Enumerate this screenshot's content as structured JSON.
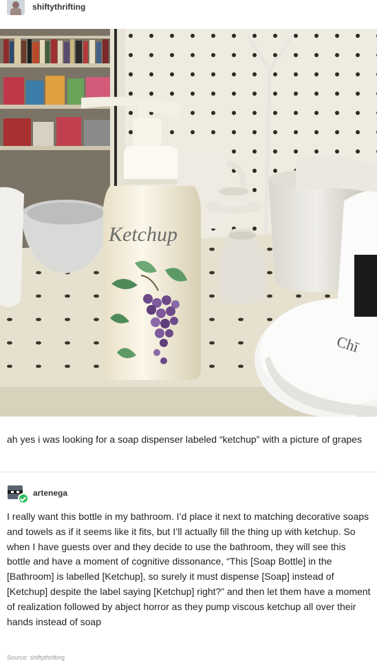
{
  "post": {
    "username": "shiftythrifting",
    "caption": "ah yes i was looking for a soap dispenser labeled “ketchup” with a picture of grapes"
  },
  "photo": {
    "label_text": "Ketchup",
    "mug_partial_text": "Chī"
  },
  "reblog": {
    "username": "artenega",
    "body": "I really want this bottle in my bathroom. I’d place it next to matching decorative soaps and towels as if it seems like it fits, but I’ll actually fill the thing up with ketchup. So when I have guests over and they decide to use the bathroom, they will see this bottle and have a moment of cognitive dissonance, “This [Soap Bottle] in the [Bathroom] is labelled [Ketchup], so surely it must dispense [Soap] instead of [Ketchup] despite the label saying [Ketchup] right?” and then let them have a moment of realization followed by abject horror as they pump viscous ketchup all over their hands instead of soap"
  },
  "footer": {
    "source_text": "Source: shiftythrifting"
  },
  "colors": {
    "verified_badge": "#2fbf5b",
    "shelf": "#e6e1cf",
    "pegboard": "#eeebe0"
  }
}
